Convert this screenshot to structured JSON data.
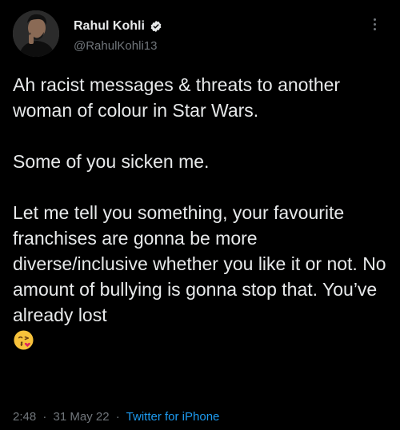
{
  "author": {
    "display_name": "Rahul Kohli",
    "handle": "@RahulKohli13"
  },
  "icons": {
    "avatar": "profile-photo",
    "verified": "verified-badge-icon",
    "more": "more-options-icon",
    "emoji": "face-blowing-kiss-emoji"
  },
  "tweet": {
    "paragraphs": [
      "Ah racist messages & threats to another woman of colour in Star Wars.",
      "Some of you sicken me.",
      "Let me tell you something, your favourite franchises are gonna be more diverse/inclusive whether you like it or not. No amount of bullying is gonna stop that. You’ve already lost"
    ]
  },
  "meta": {
    "time": "2:48",
    "date": "31 May 22",
    "separator": "·",
    "source": "Twitter for iPhone"
  },
  "colors": {
    "background": "#000000",
    "text": "#e7e9ea",
    "muted": "#71767b",
    "link": "#1d9bf0"
  }
}
